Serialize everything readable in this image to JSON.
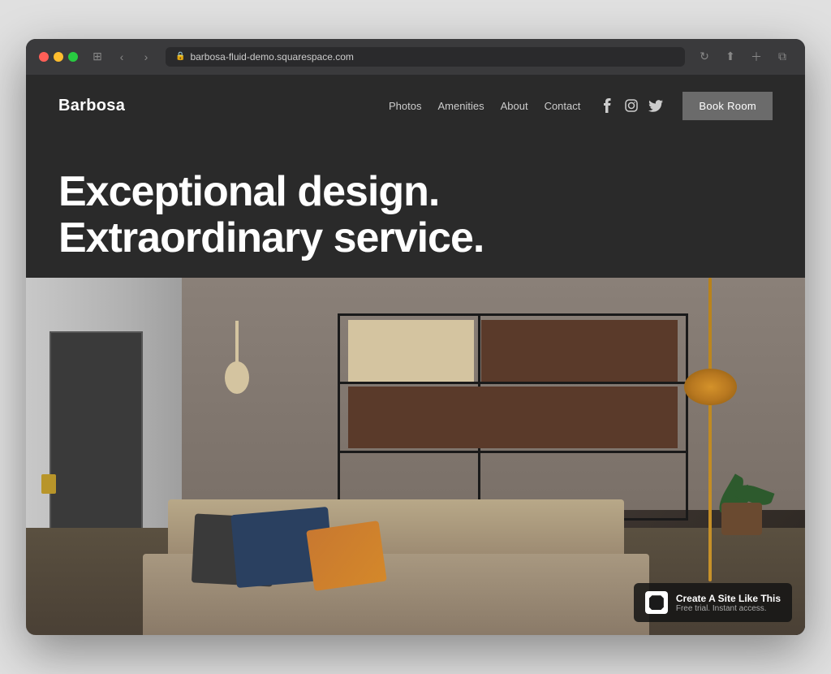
{
  "browser": {
    "url": "barbosa-fluid-demo.squarespace.com",
    "back_label": "‹",
    "forward_label": "›"
  },
  "nav": {
    "logo": "Barbosa",
    "links": [
      {
        "label": "Photos",
        "id": "photos"
      },
      {
        "label": "Amenities",
        "id": "amenities"
      },
      {
        "label": "About",
        "id": "about"
      },
      {
        "label": "Contact",
        "id": "contact"
      }
    ],
    "social": [
      {
        "label": "f",
        "id": "facebook"
      },
      {
        "label": "◎",
        "id": "instagram"
      },
      {
        "label": "🐦",
        "id": "twitter"
      }
    ],
    "cta_label": "Book Room"
  },
  "hero": {
    "title_line1": "Exceptional design.",
    "title_line2": "Extraordinary service."
  },
  "badge": {
    "main_text": "Create A Site Like This",
    "sub_text": "Free trial. Instant access."
  }
}
